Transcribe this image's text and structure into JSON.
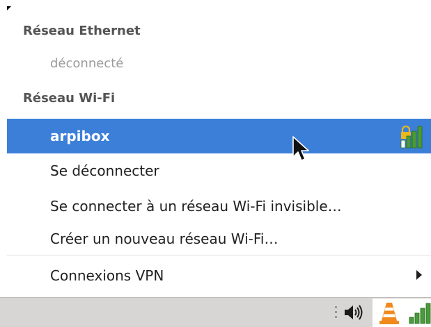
{
  "menu": {
    "ethernet_header": "Réseau Ethernet",
    "ethernet_status": "déconnecté",
    "wifi_header": "Réseau Wi-Fi",
    "network_name": "arpibox",
    "disconnect_label": "Se déconnecter",
    "hidden_network_label": "Se connecter à un réseau Wi-Fi invisible…",
    "new_network_label": "Créer un nouveau réseau Wi-Fi…",
    "vpn_label": "Connexions VPN"
  },
  "colors": {
    "selection": "#3c7fd9",
    "signal_bar": "#4a9a3a",
    "lock": "#e8b820",
    "vlc_cone": "#f08a1c"
  },
  "icons": {
    "signal": "wifi-signal-secured-icon",
    "submenu": "submenu-arrow-icon",
    "cursor": "mouse-pointer-icon",
    "tray": [
      "tray-handle-icon",
      "volume-icon",
      "vlc-icon",
      "network-signal-icon"
    ]
  }
}
